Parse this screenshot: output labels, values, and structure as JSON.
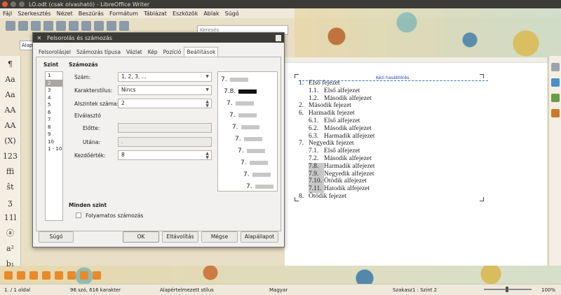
{
  "window": {
    "title": "LO.odt (csak olvasható) - LibreOffice Writer"
  },
  "menu": [
    "Fájl",
    "Szerkesztés",
    "Nézet",
    "Beszúrás",
    "Formátum",
    "Táblázat",
    "Eszközök",
    "Ablak",
    "Súgó"
  ],
  "toolbar": {
    "search_placeholder": "Keresés",
    "style_combo_value": "Alap"
  },
  "left_sidebar": [
    "¶",
    "Aa",
    "Aa",
    "AA",
    "AA",
    "(X)",
    "123",
    "ffi",
    "ŝt",
    "ʒ",
    "11l",
    "ⓐ",
    "a²",
    "b₁"
  ],
  "dialog": {
    "title": "Felsorolás és számozás",
    "tabs": [
      "Felsorolásjel",
      "Számozás típusa",
      "Vázlat",
      "Kép",
      "Pozíció",
      "Beállítások"
    ],
    "active_tab": "Beállítások",
    "level_heading": "Szint",
    "levels": [
      "1",
      "2",
      "3",
      "4",
      "5",
      "6",
      "7",
      "8",
      "9",
      "10",
      "1 - 10"
    ],
    "selected_level": "2",
    "numbering_heading": "Számozás",
    "fields": {
      "number_label": "Szám:",
      "number_value": "1, 2, 3, ...",
      "char_style_label": "Karakterstílus:",
      "char_style_value": "Nincs",
      "sublevels_label": "Alszintek száma:",
      "sublevels_value": "2",
      "separator_label": "Elválasztó",
      "before_label": "Előtte:",
      "before_value": "",
      "after_label": "Utána:",
      "after_value": ".",
      "start_label": "Kezdőérték:",
      "start_value": "8"
    },
    "all_levels_heading": "Minden szint",
    "continuous_label": "Folyamatos számozás",
    "continuous_checked": false,
    "preview": [
      "7.",
      "7.8.",
      "7.",
      "7.",
      "7.",
      "7.",
      "7.",
      "7.",
      "7.",
      "7."
    ],
    "buttons": {
      "help": "Súgó",
      "ok": "OK",
      "remove": "Eltávolítás",
      "cancel": "Mégse",
      "reset": "Alapállapot"
    }
  },
  "document": {
    "header_label": "Kézi hasábtörés",
    "list": [
      {
        "num": "1.",
        "text": "Első fejezet",
        "level": 1,
        "highlight": false
      },
      {
        "num": "1.1.",
        "text": "Első alfejezet",
        "level": 2,
        "highlight": false
      },
      {
        "num": "1.2.",
        "text": "Második alfejezet",
        "level": 2,
        "highlight": false
      },
      {
        "num": "2.",
        "text": "Második fejezet",
        "level": 1,
        "highlight": false
      },
      {
        "num": "6.",
        "text": "Harmadik fejezet",
        "level": 1,
        "highlight": false
      },
      {
        "num": "6.1.",
        "text": "Első alfejezet",
        "level": 2,
        "highlight": false
      },
      {
        "num": "6.2.",
        "text": "Második alfejezet",
        "level": 2,
        "highlight": false
      },
      {
        "num": "6.3.",
        "text": "Harmadik alfejezet",
        "level": 2,
        "highlight": false
      },
      {
        "num": "7.",
        "text": "Negyedik fejezet",
        "level": 1,
        "highlight": false
      },
      {
        "num": "7.1.",
        "text": "Első alfejezet",
        "level": 2,
        "highlight": false
      },
      {
        "num": "7.2.",
        "text": "Második alfejezet",
        "level": 2,
        "highlight": false
      },
      {
        "num": "7.8.",
        "text": "Harmadik alfejezet",
        "level": 2,
        "highlight": true
      },
      {
        "num": "7.9.",
        "text": "Negyedik alfejezet",
        "level": 2,
        "highlight": true
      },
      {
        "num": "7.10.",
        "text": "Ötödik alfejezet",
        "level": 2,
        "highlight": true
      },
      {
        "num": "7.11.",
        "text": "Hatodik alfejezet",
        "level": 2,
        "highlight": true
      },
      {
        "num": "8.",
        "text": "Ötödik fejezet",
        "level": 1,
        "highlight": false
      }
    ]
  },
  "status": {
    "page": "1. / 1 oldal",
    "words": "96 szó, 616 karakter",
    "page_style": "Alapértelmezett stílus",
    "language": "Magyar",
    "section": "Szakasz1 : Szint 2",
    "zoom": "100%"
  }
}
